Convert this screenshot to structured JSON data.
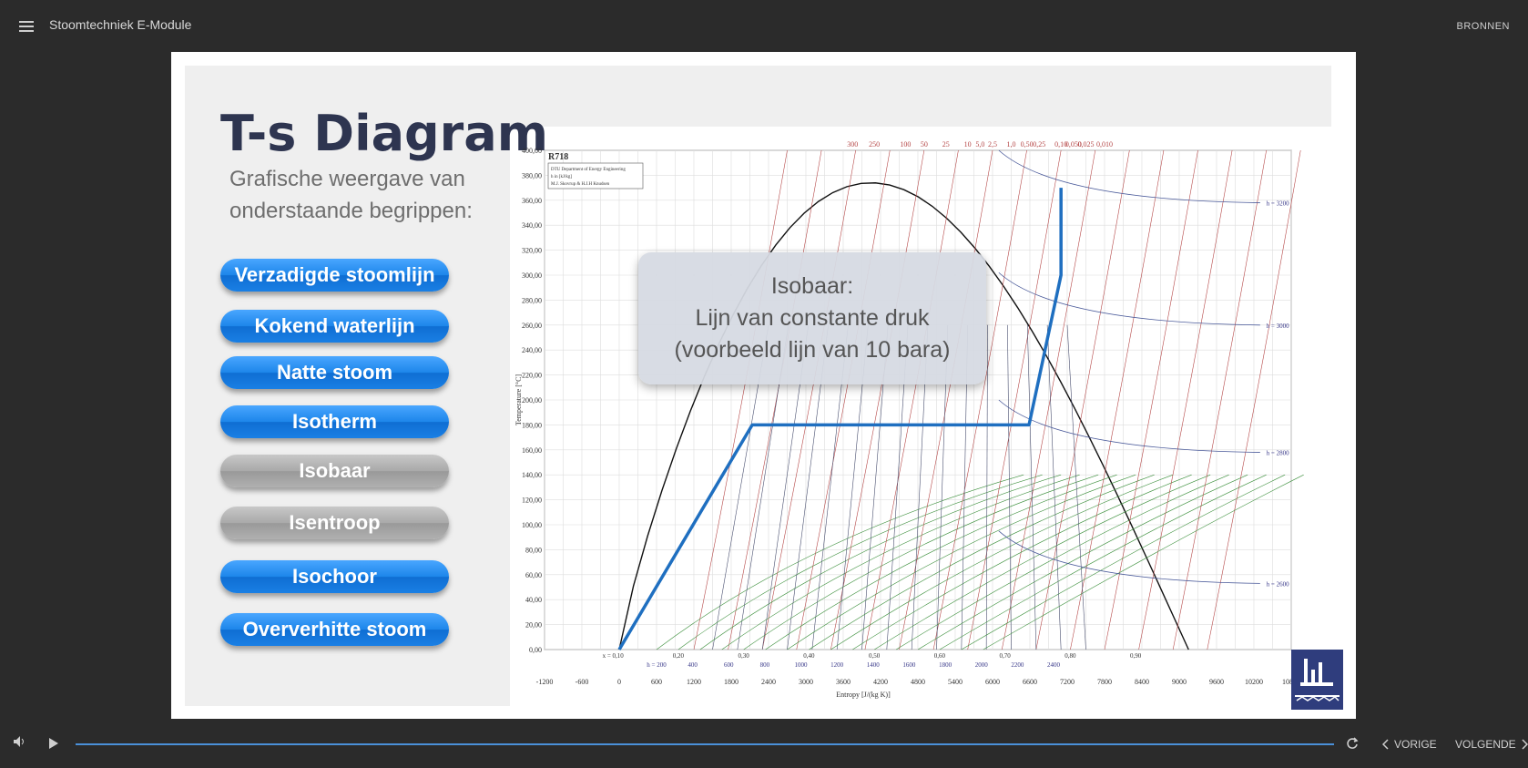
{
  "header": {
    "app_title": "Stoomtechniek E-Module",
    "bronnen_label": "BRONNEN"
  },
  "slide": {
    "title": "T-s Diagram",
    "subtitle": "Grafische weergave van onderstaande begrippen:",
    "buttons": [
      {
        "label": "Verzadigde stoomlijn",
        "color": "blue"
      },
      {
        "label": "Kokend waterlijn",
        "color": "blue"
      },
      {
        "label": "Natte stoom",
        "color": "blue"
      },
      {
        "label": "Isotherm",
        "color": "blue"
      },
      {
        "label": "Isobaar",
        "color": "grey"
      },
      {
        "label": "Isentroop",
        "color": "grey"
      },
      {
        "label": "Isochoor",
        "color": "blue"
      },
      {
        "label": "Oververhitte stoom",
        "color": "blue"
      }
    ],
    "overlay": {
      "line1": "Isobaar:",
      "line2": "Lijn van constante druk",
      "line3": "(voorbeeld lijn van 10 bara)"
    },
    "diagram": {
      "heading": "R718",
      "legend": [
        "DTU Department of Energy Engineering",
        "h in [kJ/kg]",
        "M.J. Skovrup & H.J.H Knudsen"
      ],
      "ylabel": "Temperature [°C]",
      "xlabel": "Entropy [J/(kg K)]",
      "y_ticks": [
        "0,00",
        "20,00",
        "40,00",
        "60,00",
        "80,00",
        "100,00",
        "120,00",
        "140,00",
        "160,00",
        "180,00",
        "200,00",
        "220,00",
        "240,00",
        "260,00",
        "280,00",
        "300,00",
        "320,00",
        "340,00",
        "360,00",
        "380,00",
        "400,00"
      ],
      "x_ticks": [
        "-1200",
        "-600",
        "0",
        "600",
        "1200",
        "1800",
        "2400",
        "3000",
        "3600",
        "4200",
        "4800",
        "5400",
        "6000",
        "6600",
        "7200",
        "7800",
        "8400",
        "9000",
        "9600",
        "10200",
        "10800"
      ],
      "top_pressures": [
        "300",
        "250",
        "100",
        "50",
        "25",
        "10",
        "5,0",
        "2,5",
        "1,0",
        "0,50",
        "0,25",
        "0,10",
        "0,050",
        "0,025",
        "0,010"
      ],
      "quality_labels": [
        "x = 0,10",
        "0,20",
        "0,30",
        "0,40",
        "0,50",
        "0,60",
        "0,70",
        "0,80",
        "0,90"
      ],
      "enthalpy_labels": [
        "h = 200",
        "400",
        "600",
        "800",
        "1000",
        "1200",
        "1400",
        "1600",
        "1800",
        "2000",
        "2200",
        "2400"
      ],
      "h_curves": [
        "h = 3200",
        "h = 3000",
        "h = 2800",
        "h = 2600"
      ],
      "isobar_10_bara": [
        [
          0,
          0
        ],
        [
          2138,
          180
        ],
        [
          6586,
          180
        ],
        [
          7100,
          300
        ],
        [
          7100,
          370
        ]
      ],
      "colors": {
        "isobar_highlight": "#1f6fc0",
        "isobar": "#b54747",
        "isochore": "#3b8f3b",
        "dome": "#111111"
      }
    }
  },
  "footer": {
    "prev_label": "VORIGE",
    "next_label": "VOLGENDE"
  },
  "progress": {
    "value": 1.0
  },
  "colors": {
    "background": "#2b2b2b",
    "accent_blue": "#1d86ea",
    "title": "#2e3550"
  }
}
